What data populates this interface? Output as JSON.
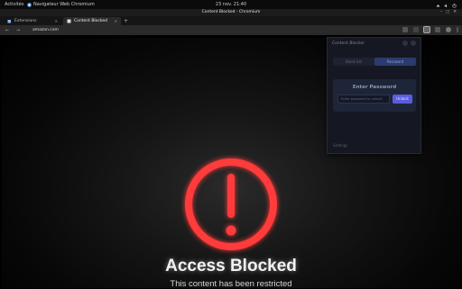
{
  "topbar": {
    "activities": "Activités",
    "app_name": "Navigateur Web Chromium",
    "clock": "23 nov.  21:40"
  },
  "window": {
    "title": "Content Blocked - Chromium"
  },
  "tabs": [
    {
      "label": "Extensions"
    },
    {
      "label": "Content Blocked"
    }
  ],
  "toolbar": {
    "url": "amazon.com"
  },
  "page": {
    "title": "Access Blocked",
    "subtitle": "This content has been restricted",
    "icon": "exclamation-circle-icon",
    "accent_color": "#ff3b3b"
  },
  "popup": {
    "header": "Content Blocker",
    "segments": [
      {
        "label": "Block list"
      },
      {
        "label": "Password"
      }
    ],
    "password_title": "Enter Password",
    "password_placeholder": "Enter password to unlock",
    "unlock_label": "Unlock",
    "footer": "Settings"
  }
}
